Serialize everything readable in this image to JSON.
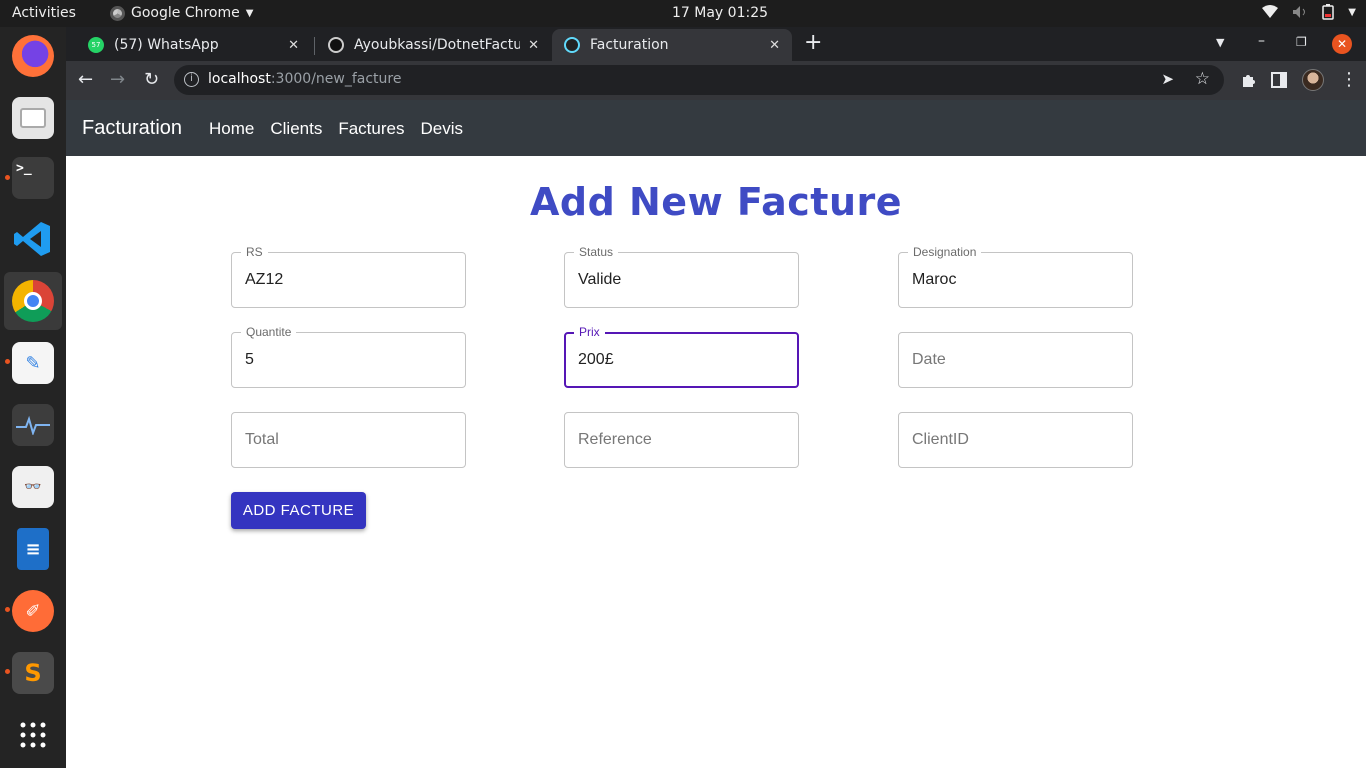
{
  "system": {
    "activities": "Activities",
    "app_name": "Google Chrome",
    "clock": "17 May  01:25"
  },
  "browser": {
    "tabs": [
      {
        "title": "(57) WhatsApp",
        "favicon": "whatsapp-icon",
        "badge": "57"
      },
      {
        "title": "Ayoubkassi/DotnetFactur",
        "favicon": "github-icon"
      },
      {
        "title": "Facturation",
        "favicon": "react-icon",
        "active": true
      }
    ],
    "url_host": "localhost",
    "url_path": ":3000/new_facture"
  },
  "navbar": {
    "brand": "Facturation",
    "links": [
      "Home",
      "Clients",
      "Factures",
      "Devis"
    ]
  },
  "form": {
    "title": "Add New Facture",
    "fields": [
      {
        "label": "RS",
        "value": "AZ12",
        "placeholder": ""
      },
      {
        "label": "Status",
        "value": "Valide",
        "placeholder": ""
      },
      {
        "label": "Designation",
        "value": "Maroc",
        "placeholder": ""
      },
      {
        "label": "Quantite",
        "value": "5",
        "placeholder": ""
      },
      {
        "label": "Prix",
        "value": "200£",
        "placeholder": "",
        "focused": true
      },
      {
        "label": "",
        "value": "",
        "placeholder": "Date"
      },
      {
        "label": "",
        "value": "",
        "placeholder": "Total"
      },
      {
        "label": "",
        "value": "",
        "placeholder": "Reference"
      },
      {
        "label": "",
        "value": "",
        "placeholder": "ClientID"
      }
    ],
    "submit_label": "ADD FACTURE"
  },
  "colors": {
    "accent": "#3f4bc4",
    "button": "#3434c0",
    "focus": "#5516b5",
    "navbar": "#343a40"
  }
}
